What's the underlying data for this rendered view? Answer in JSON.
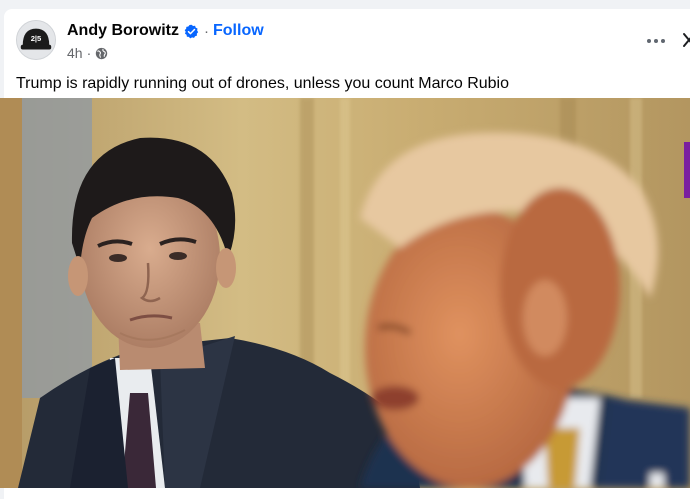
{
  "post": {
    "author": "Andy Borowitz",
    "follow_label": "Follow",
    "separator": "·",
    "timestamp": "4h",
    "caption": "Trump is rapidly running out of drones, unless you count Marco Rubio",
    "avatar_text": "2|5"
  },
  "colors": {
    "accent": "#0866ff",
    "meta_text": "#65676b",
    "primary_text": "#050505"
  },
  "icons": {
    "verified": "verified-badge-icon",
    "audience": "globe-icon",
    "more": "more-options-icon",
    "close": "close-icon"
  }
}
